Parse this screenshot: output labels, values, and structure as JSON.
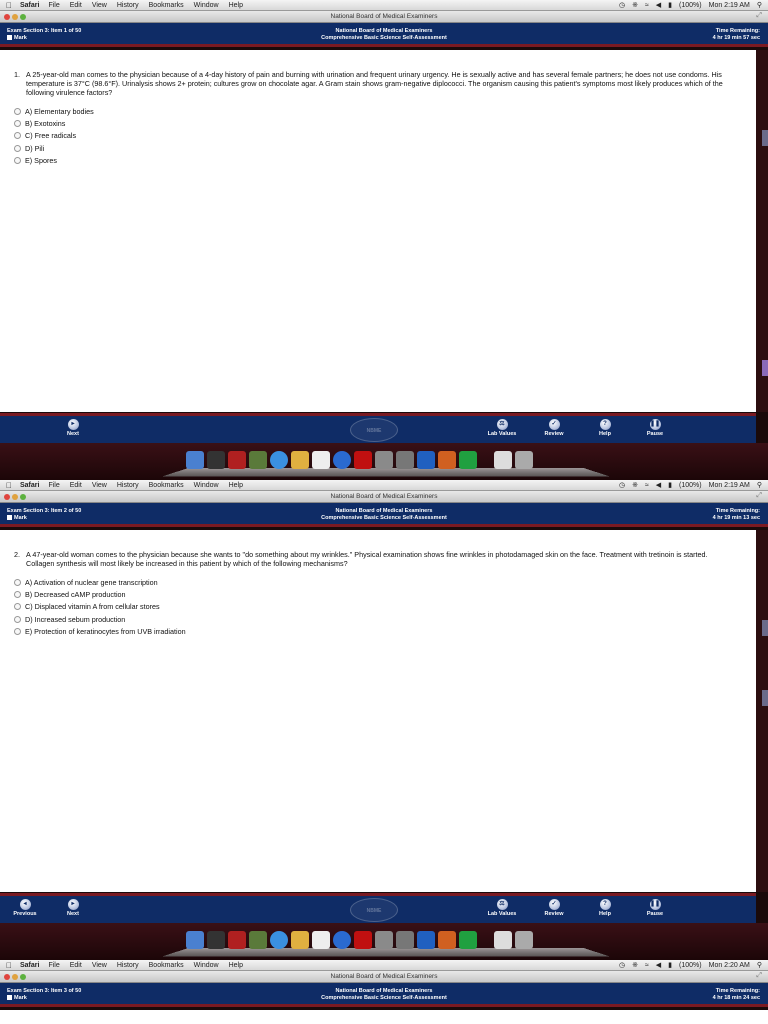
{
  "menubar": {
    "app": "Safari",
    "items": [
      "File",
      "Edit",
      "View",
      "History",
      "Bookmarks",
      "Window",
      "Help"
    ],
    "battery": "(100%)"
  },
  "window_title": "National Board of Medical Examiners",
  "exam": {
    "center_line1": "National Board of Medical Examiners",
    "center_line2": "Comprehensive Basic Science Self-Assessment",
    "time_label": "Time Remaining:",
    "mark_label": "Mark"
  },
  "screens": [
    {
      "clock": "Mon 2:19 AM",
      "item_label": "Exam Section 3: Item 1 of 50",
      "time_value": "4 hr 19 min 57 sec",
      "question_number": "1.",
      "stem": "A 25-year-old man comes to the physician because of a 4-day history of pain and burning with urination and frequent urinary urgency. He is sexually active and has several female partners; he does not use condoms. His temperature is 37°C (98.6°F). Urinalysis shows 2+ protein; cultures grow on chocolate agar. A Gram stain shows gram-negative diplococci. The organism causing this patient's symptoms most likely produces which of the following virulence factors?",
      "choices": [
        "A) Elementary bodies",
        "B) Exotoxins",
        "C) Free radicals",
        "D) Pili",
        "E) Spores"
      ]
    },
    {
      "clock": "Mon 2:19 AM",
      "item_label": "Exam Section 3: Item 2 of 50",
      "time_value": "4 hr 19 min 13 sec",
      "question_number": "2.",
      "stem": "A 47-year-old woman comes to the physician because she wants to \"do something about my wrinkles.\" Physical examination shows fine wrinkles in photodamaged skin on the face. Treatment with tretinoin is started. Collagen synthesis will most likely be increased in this patient by which of the following mechanisms?",
      "choices": [
        "A) Activation of nuclear gene transcription",
        "B) Decreased cAMP production",
        "C) Displaced vitamin A from cellular stores",
        "D) Increased sebum production",
        "E) Protection of keratinocytes from UVB irradiation"
      ]
    },
    {
      "clock": "Mon 2:20 AM",
      "item_label": "Exam Section 3: Item 3 of 50",
      "time_value": "4 hr 18 min 24 sec"
    }
  ],
  "nav": {
    "previous": "Previous",
    "next": "Next",
    "lab_values": "Lab Values",
    "review": "Review",
    "help": "Help",
    "pause": "Pause"
  },
  "dock_icons": [
    "finder-icon",
    "dashboard-icon",
    "dictionary-icon",
    "ichat-icon",
    "safari-icon",
    "notes-icon",
    "ical-icon",
    "itunes-icon",
    "photobooth-icon",
    "iphoto-icon",
    "system-prefs-icon",
    "word-icon",
    "powerpoint-icon",
    "excel-icon",
    "downloads-icon",
    "trash-icon"
  ]
}
